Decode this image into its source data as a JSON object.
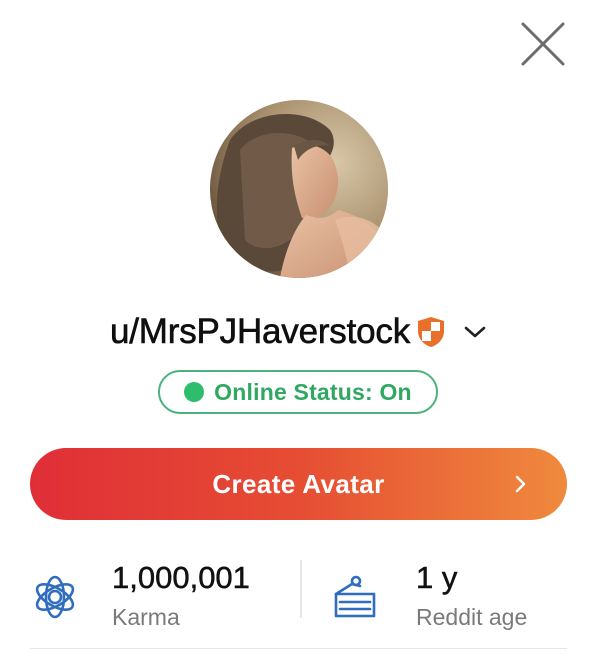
{
  "profile": {
    "username": "u/MrsPJHaverstock",
    "avatar_alt": "Profile photo"
  },
  "status": {
    "label": "Online Status: On",
    "online": true,
    "color": "#2ebe6b"
  },
  "create_avatar": {
    "label": "Create Avatar",
    "gradient": [
      "#e02e37",
      "#ef8a3d"
    ]
  },
  "stats": {
    "karma": {
      "value": "1,000,001",
      "label": "Karma",
      "icon": "karma-flower-icon"
    },
    "age": {
      "value": "1 y",
      "label": "Reddit age",
      "icon": "cake-icon"
    }
  },
  "icons": {
    "close": "close-icon",
    "badge": "shield-badge-icon",
    "dropdown": "chevron-down-icon",
    "button_arrow": "chevron-right-icon"
  },
  "colors": {
    "accent_blue": "#2f6dbe",
    "badge_orange": "#e8702a",
    "status_green": "#2fa862"
  }
}
